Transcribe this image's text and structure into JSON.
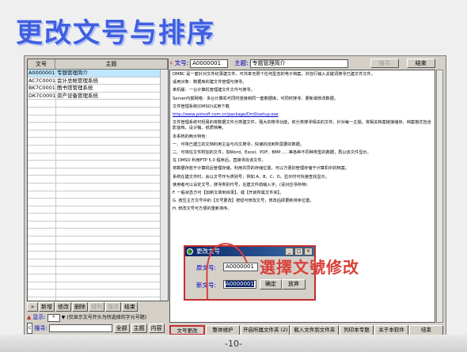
{
  "slide": {
    "title": "更改文号与排序",
    "page_number": "-10-",
    "callout": "選擇文號修改",
    "accent_color": "#3f5fe0",
    "callout_color": "#d9403a"
  },
  "list": {
    "headers": [
      "文号",
      "主题"
    ],
    "rows": [
      {
        "code": "A0000001",
        "subject": "专题管理简介",
        "selected": true
      },
      {
        "code": "AC7C0001",
        "subject": "会计总帐管理系统"
      },
      {
        "code": "BK7C0001",
        "subject": "图书馆管理系统"
      },
      {
        "code": "DK7C0001",
        "subject": "资产设备管理系统"
      }
    ],
    "buttons": {
      "add": "新增",
      "edit": "修改",
      "delete": "删除",
      "sort": "排列",
      "search": "搜寻",
      "close": "结束"
    },
    "display_label": "显示:",
    "display_value": "*",
    "display_hint": "(仅显示文号开头为所选择的字元号题)",
    "search_label": "搜寻:",
    "all_label": "全部",
    "subject_label": "主题",
    "content_label": "内容"
  },
  "detail": {
    "code_label": "文号:",
    "code_value": "A0000001",
    "subject_label": "主题:",
    "subject_value": "专题管理简介",
    "search_button": "搜寻",
    "close_button": "结束",
    "doc_paragraphs": [
      "DMBC 是一套针对文件纪录建文件，可共率无限个任何型态的电子档案，并自行输入关键词搜寻已建文件文件。",
      "适用对象：数据库的建文件管理与搜寻。",
      "单机版：一台计算机管理建文件文件与搜寻。",
      "Server内部网络：多台计算机可同时连接到同一套数据库，可同时搜寻、更新或修改数据。",
      "文件管理系统(DMSO)试用下载",
      "文件管理系统可轻易的将数据文件分类建文件，强大的搜寻功能，依分类搜寻相关的文件。针对每一主题，将相关档案链接储存，档案格式包含影音档、设计稿、纸质档等。",
      "本系统的两大特色：",
      "一、可将已建立的文档利用主旨与内文搜寻，快速的找到所需要的数据。",
      "二、可将任文件附加的文件，如Word、Excel、PDF、BMP……等各种不同种类型的数据，再以该文件显示。",
      "在 DMSO 利用FTP 5.0 程序后，直接寻找该文件。",
      "将数据存放于计算机后管理存储，利用共同的存储位置，可以方便的管理存储于计算机中的档案。",
      "系统在建文件时，会以文号作为类别号，例如 A、B、C、D。显示时可快速查找显示。",
      "使用者可以设定文号，搜寻类别代号，在建文件前输入字。(请对应寻存档)",
      "F. 一般状态方可【加新文章到目录】，或【开启所属文件夹】。",
      "G. 按压主方文号中的【文号更改】按钮可修改文号，修改后即更新排序位置。",
      "H. 修改文号可方便的重新排序。"
    ],
    "doc_link": "http://www.potsoft.com.cn/package/DmStsetup.exe",
    "bottom_buttons": [
      {
        "label": "文号更改",
        "active": true
      },
      {
        "label": "整体维护"
      },
      {
        "label": "开启所属文件夹 (2)"
      },
      {
        "label": "载入文件到文件夹"
      },
      {
        "label": "列印本专题"
      },
      {
        "label": "关于本软件"
      },
      {
        "label": "结束"
      }
    ]
  },
  "dialog": {
    "title": "更改文号",
    "old_label": "原文号:",
    "old_value": "A0000001",
    "new_label": "新文号:",
    "new_value": "A0000001",
    "confirm_button": "确定",
    "cancel_button": "放弃",
    "controls": [
      "_",
      "□",
      "×"
    ]
  }
}
